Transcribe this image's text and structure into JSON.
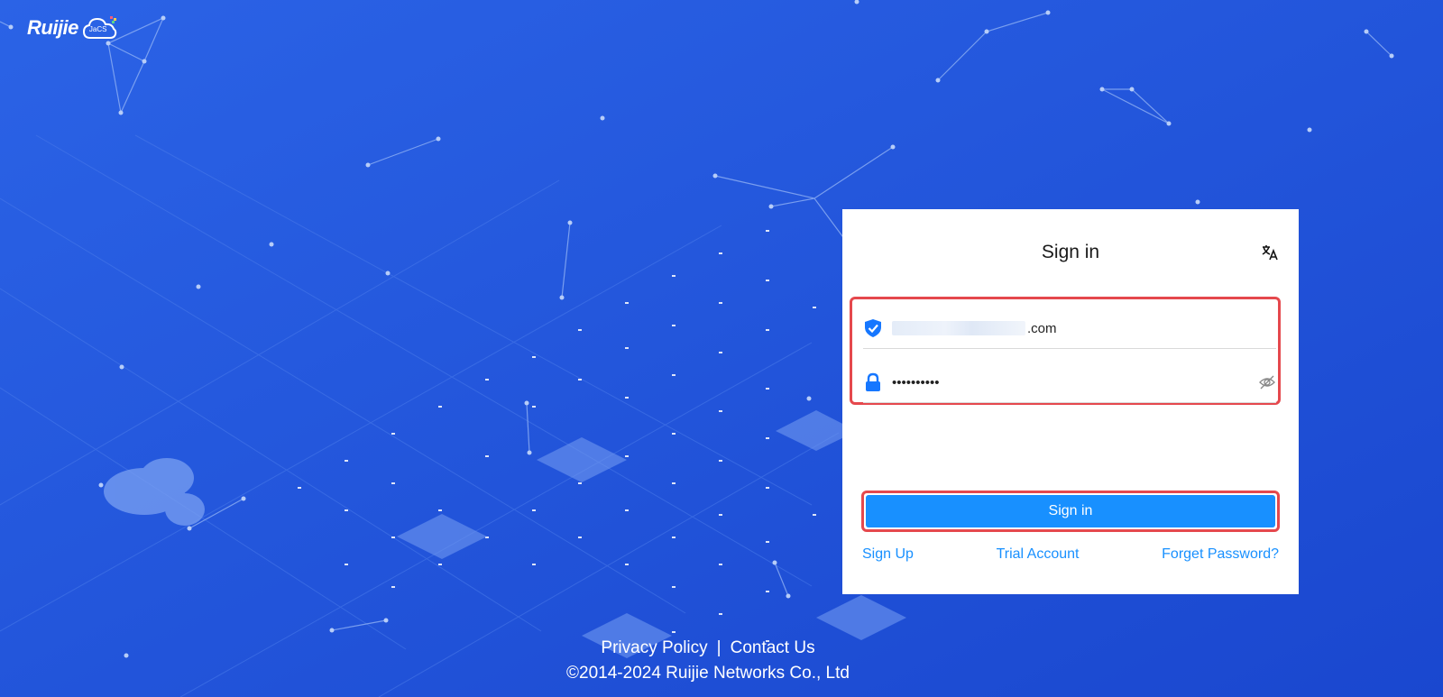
{
  "brand": {
    "logo_text": "Ruijie",
    "cloud_text": "JaCS",
    "logo_icon": "cloud-icon"
  },
  "signin": {
    "title": "Sign in",
    "language_icon": "translate-icon",
    "username": {
      "icon": "shield-check-icon",
      "visible_suffix": ".com"
    },
    "password": {
      "icon": "lock-icon",
      "value": "••••••••••",
      "toggle_icon": "eye-off-icon"
    },
    "submit_label": "Sign in",
    "links": {
      "sign_up": "Sign Up",
      "trial": "Trial Account",
      "forgot": "Forget Password?"
    }
  },
  "footer": {
    "privacy": "Privacy Policy",
    "separator": "|",
    "contact": "Contact Us",
    "copyright": "©2014-2024 Ruijie Networks Co., Ltd"
  },
  "colors": {
    "background": "#1c50d8",
    "accent": "#1890ff",
    "highlight_border": "#e5484d"
  }
}
